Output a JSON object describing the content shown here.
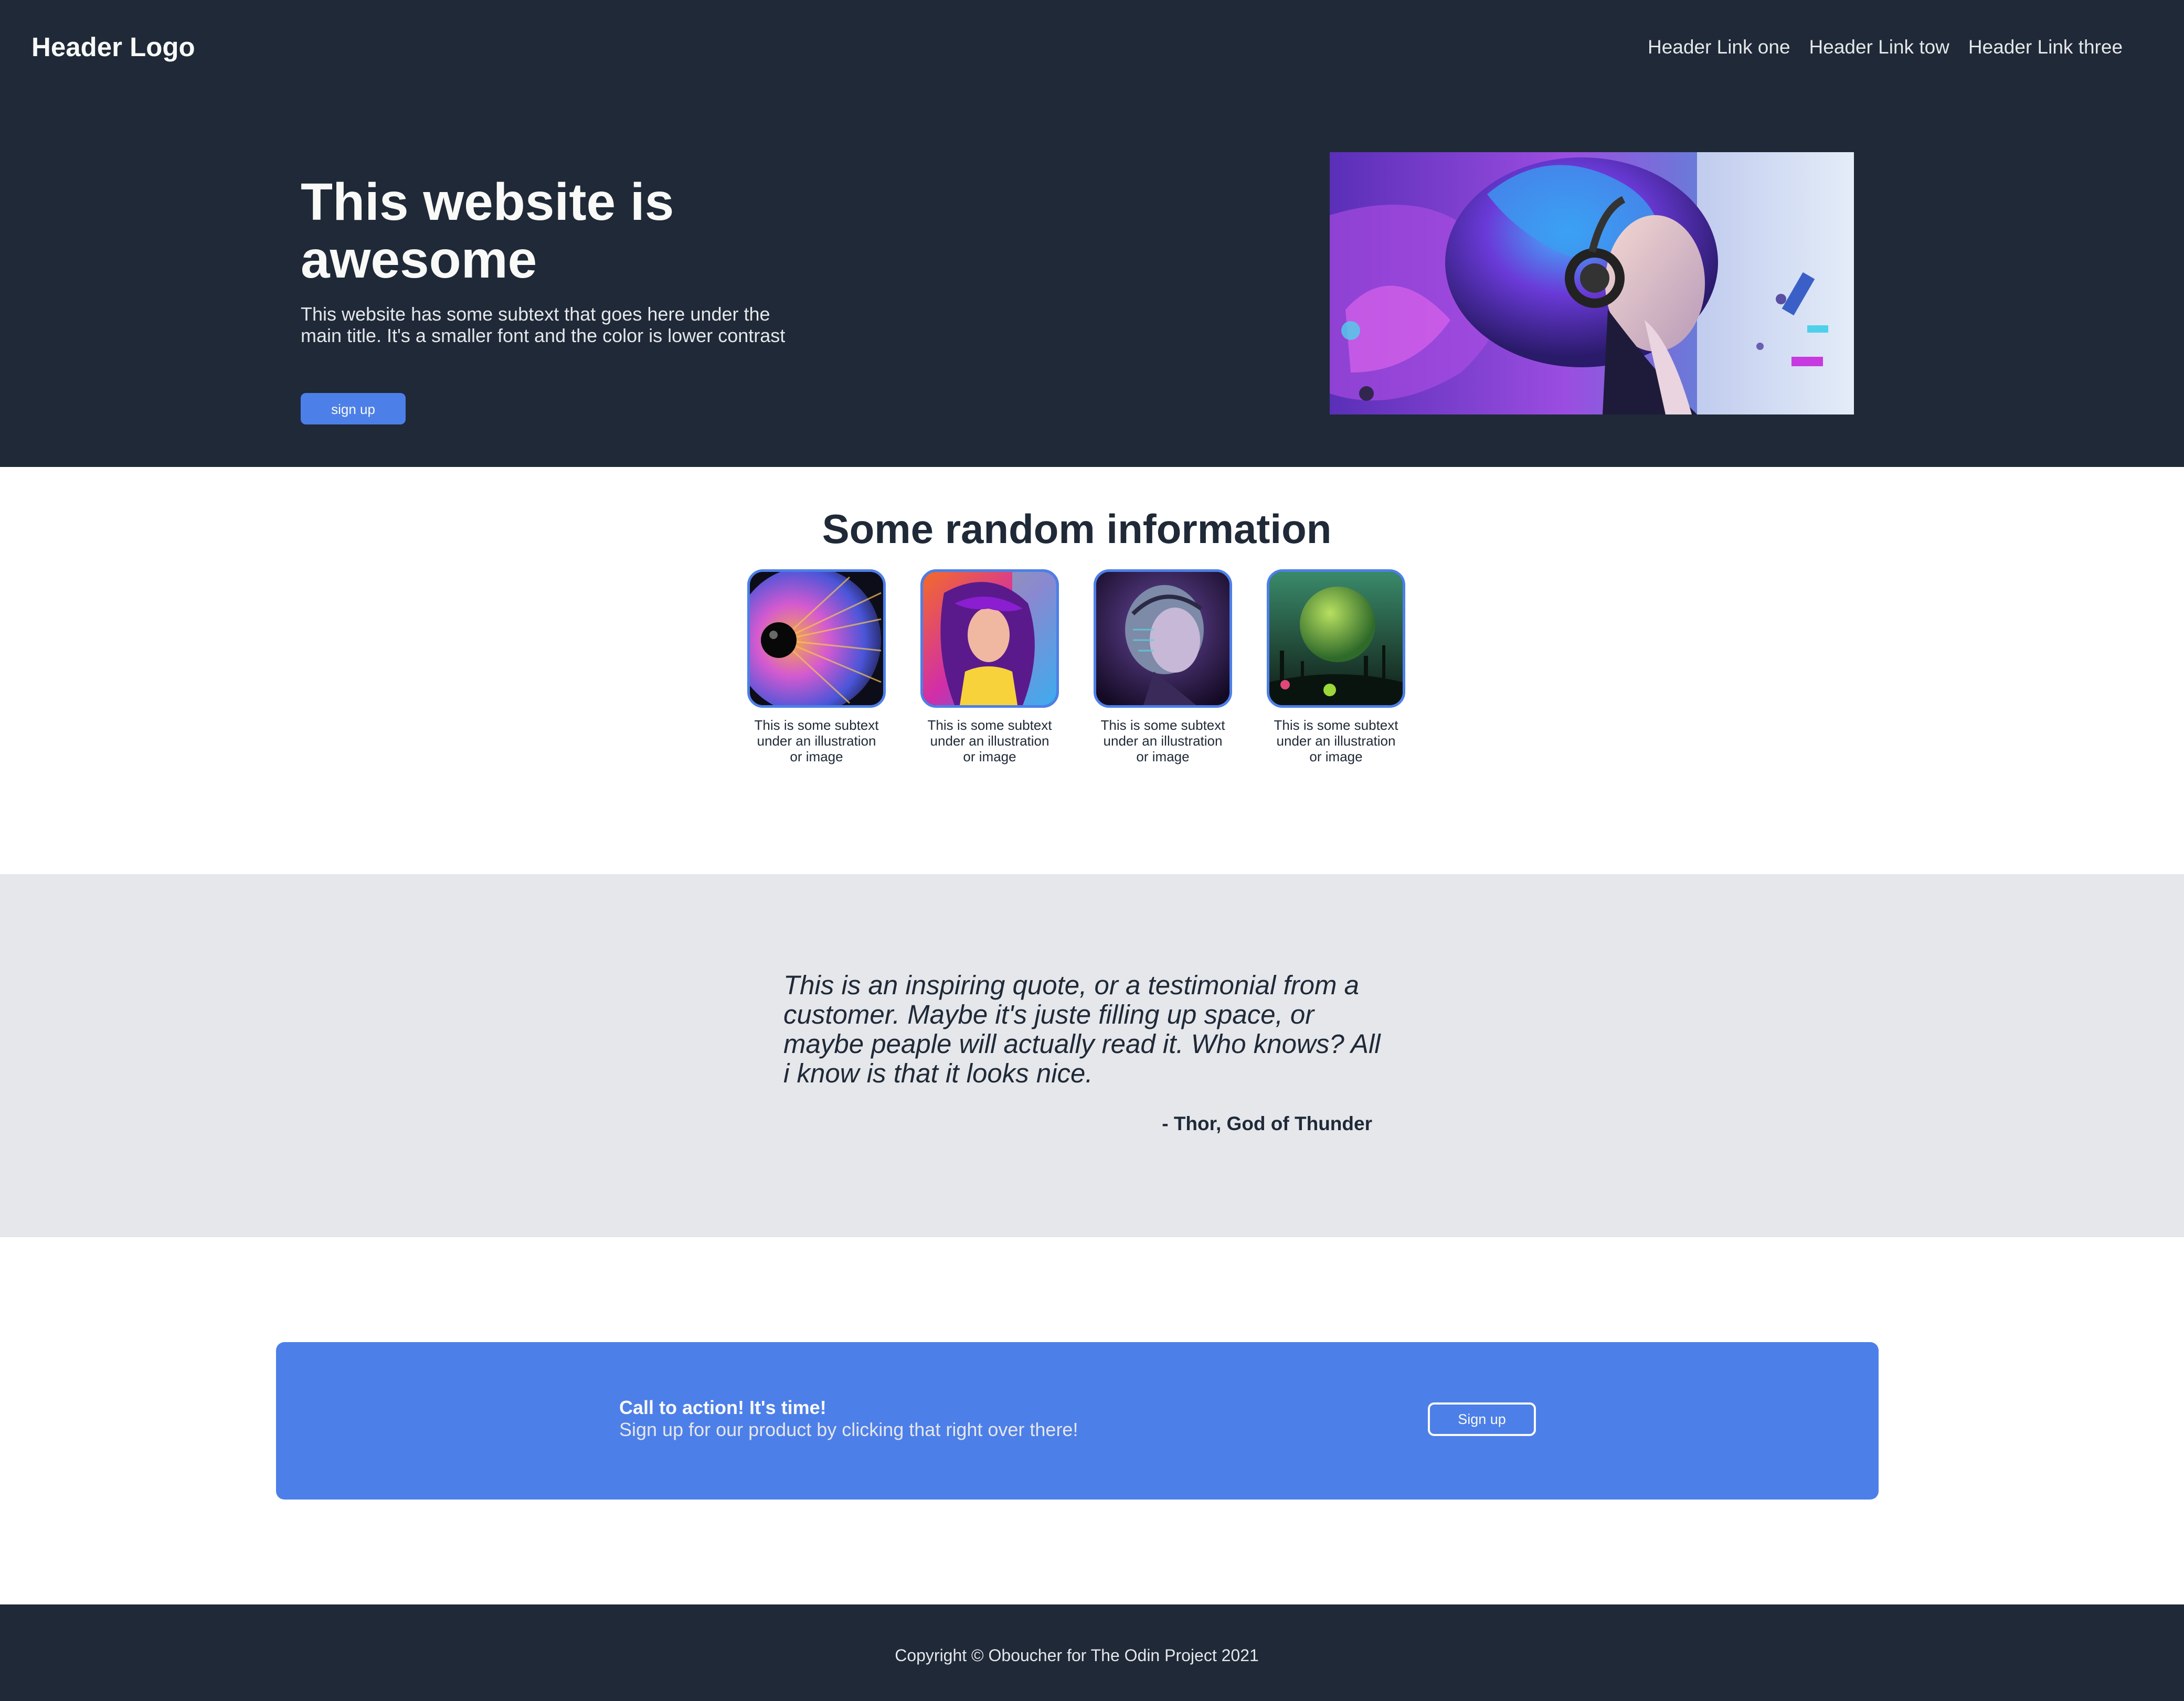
{
  "header": {
    "logo": "Header Logo",
    "links": [
      "Header Link one",
      "Header Link tow",
      "Header Link three"
    ]
  },
  "hero": {
    "title": "This website is awesome",
    "subtext": "This website has some subtext that goes here under the main title. It's a smaller font and the color is lower contrast",
    "button_label": "sign up",
    "image_icon": "portrait-illustration-headphones"
  },
  "info": {
    "title": "Some random information",
    "cards": [
      {
        "caption": "This is some subtext under an illustration or image",
        "image_icon": "eye-illustration"
      },
      {
        "caption": "This is some subtext under an illustration or image",
        "image_icon": "colorful-girl-illustration"
      },
      {
        "caption": "This is some subtext under an illustration or image",
        "image_icon": "robot-head-illustration"
      },
      {
        "caption": "This is some subtext under an illustration or image",
        "image_icon": "green-planet-illustration"
      }
    ]
  },
  "quote": {
    "text": "This is an inspiring quote, or a testimonial from a customer. Maybe it's juste filling up space, or maybe peaple will actually read it. Who knows? All i know is that it looks nice.",
    "author": "- Thor, God of Thunder"
  },
  "cta": {
    "title": "Call to action! It's time!",
    "subtext": "Sign up for our product by clicking that right over there!",
    "button_label": "Sign up"
  },
  "footer": {
    "copyright": "Copyright © Oboucher for The Odin Project 2021"
  },
  "colors": {
    "dark": "#1f2937",
    "accent": "#4d7fe8",
    "light_gray": "#e5e7eb",
    "white": "#f9faf8"
  }
}
